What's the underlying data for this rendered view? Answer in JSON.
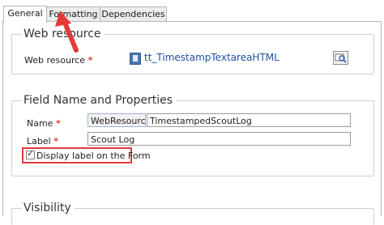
{
  "tabs": [
    {
      "label": "General",
      "active": true
    },
    {
      "label": "Formatting",
      "active": false
    },
    {
      "label": "Dependencies",
      "active": false
    }
  ],
  "web_resource_section": {
    "legend": "Web resource",
    "field_label": "Web resource",
    "required_marker": "*",
    "value": "tt_TimestampTextareaHTML",
    "value_icon": "webresource-file-icon",
    "lookup_button_icon": "lookup-search-icon"
  },
  "field_section": {
    "legend": "Field Name and Properties",
    "name_label": "Name",
    "name_required": "*",
    "name_prefix": "WebResource_",
    "name_value": "TimestampedScoutLog",
    "label_label": "Label",
    "label_required": "*",
    "label_value": "Scout Log",
    "display_label_text": "Display label on the Form",
    "display_label_checked": true,
    "checkmark": "✓"
  },
  "visibility_section": {
    "legend": "Visibility"
  },
  "annotation": {
    "arrow_color": "#e23b3b",
    "highlight_color": "#e23b3b"
  }
}
